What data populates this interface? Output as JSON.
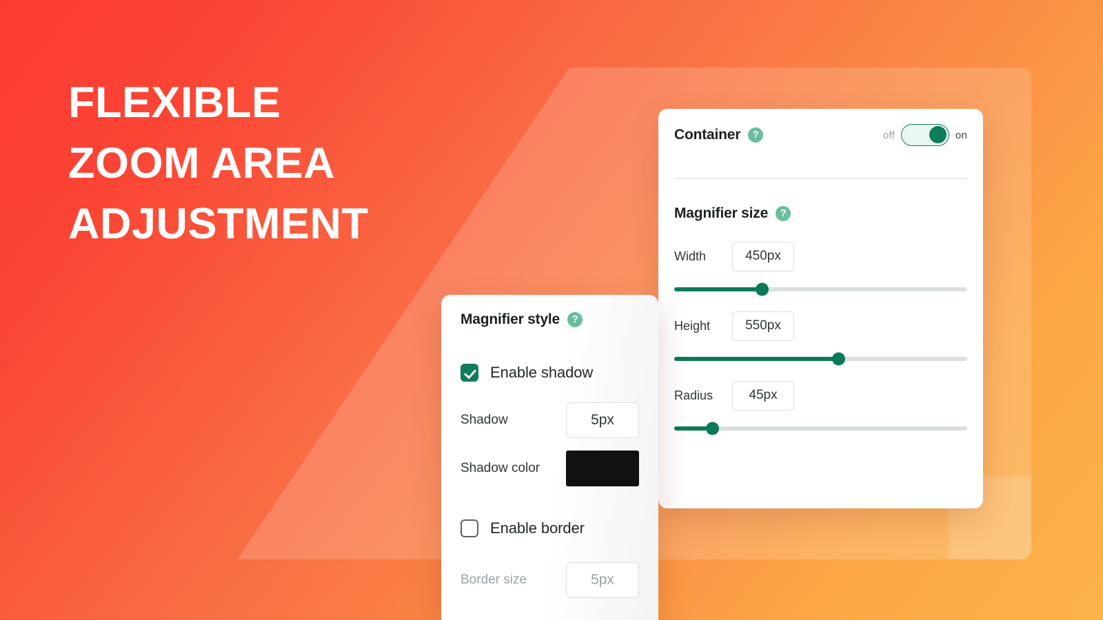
{
  "headline": {
    "line1": "FLEXIBLE",
    "line2": "ZOOM AREA",
    "line3": "ADJUSTMENT"
  },
  "theme": {
    "background_start": "#FC3A32",
    "background_end": "#FDB24A",
    "accent_green": "#0F7C5B",
    "help_icon_green": "#69BE9B",
    "slider_track": "#DCDFE1"
  },
  "settings_panel": {
    "container": {
      "label": "Container",
      "help_icon": "question-mark-icon",
      "toggle_off_label": "off",
      "toggle_on_label": "on",
      "toggle_state": "on"
    },
    "magnifier_size": {
      "label": "Magnifier size",
      "help_icon": "question-mark-icon",
      "fields": [
        {
          "label": "Width",
          "value": "450px",
          "slider_percent": 30
        },
        {
          "label": "Height",
          "value": "550px",
          "slider_percent": 56
        },
        {
          "label": "Radius",
          "value": "45px",
          "slider_percent": 13
        }
      ]
    }
  },
  "style_panel": {
    "title": "Magnifier style",
    "help_icon": "question-mark-icon",
    "enable_shadow": {
      "label": "Enable shadow",
      "checked": true
    },
    "shadow": {
      "label": "Shadow",
      "value": "5px"
    },
    "shadow_color": {
      "label": "Shadow color",
      "value": "#111111"
    },
    "enable_border": {
      "label": "Enable border",
      "checked": false
    },
    "border_size": {
      "label": "Border size",
      "value": "5px",
      "disabled": true
    }
  }
}
